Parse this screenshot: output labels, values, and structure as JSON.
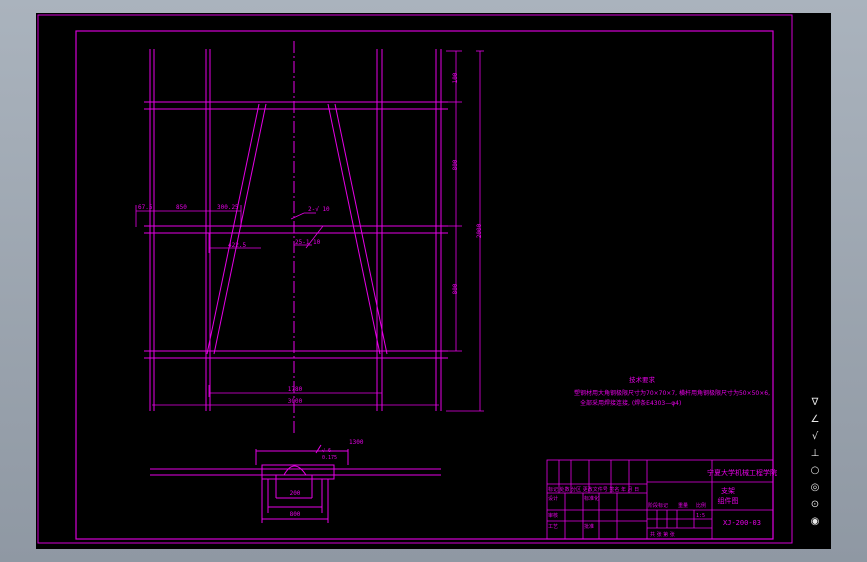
{
  "colors": {
    "background": "#000000",
    "line": "#e600e6",
    "frame": "#d400d4",
    "outer_bg": "#9aa3ad",
    "symbols": "#e0e0e0"
  },
  "dimensions": {
    "top_right": [
      "100",
      "800",
      "800"
    ],
    "overall_height": "2000",
    "left_pair": [
      "67.5",
      "850",
      "300.25"
    ],
    "center_labels": [
      "2-√ 10",
      "25-1 10",
      "422.5"
    ],
    "bottom_inner": "1780",
    "bottom_overall": "3000",
    "detail_top_length": "1300",
    "detail_callout": [
      "√ 6",
      "0.175"
    ],
    "detail_widths": [
      "200",
      "800"
    ]
  },
  "tech_requirements": {
    "title": "技术要求",
    "lines": [
      "塑钢材用大角钢极限尺寸为70×70×7, 横杆用角钢极限尺寸为50×50×6,",
      "全部采用焊接连接,        (焊条E4303—φ4)"
    ]
  },
  "title_block": {
    "school": "宁夏大学机械工程学院",
    "drawing_name": "支架",
    "drawing_name_sub": "组件图",
    "drawing_number": "XJ-200-03",
    "scale": "1:5",
    "weight_label": "重量",
    "scale_label": "比例",
    "sheet_label": "共  张  第  张",
    "mark_columns": "标记 处数 分区 更改文件号 签名 年 月 日",
    "designer": "设计",
    "standardization": "标准化",
    "review": "审核",
    "process": "工艺",
    "approve": "批准",
    "stage_label": "阶段标记"
  },
  "toolbar": {
    "items": [
      "∇",
      "∠",
      "√",
      "⊥",
      "○",
      "◎",
      "⊙",
      "◉"
    ]
  }
}
